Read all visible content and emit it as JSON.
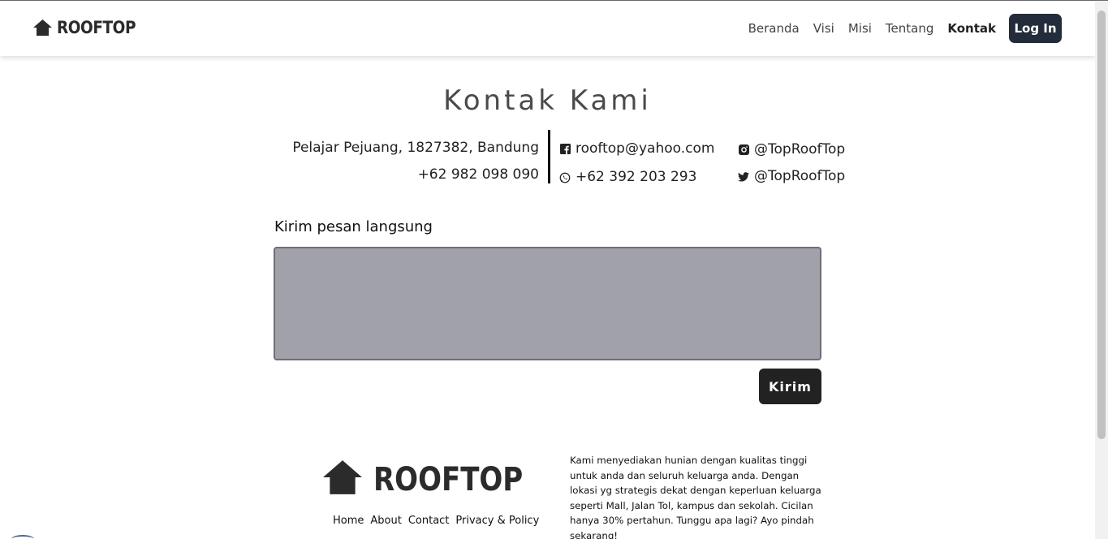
{
  "brand": {
    "name": "ROOFTOP",
    "icon": "house-icon"
  },
  "nav": {
    "items": [
      {
        "label": "Beranda",
        "active": false
      },
      {
        "label": "Visi",
        "active": false
      },
      {
        "label": "Misi",
        "active": false
      },
      {
        "label": "Tentang",
        "active": false
      },
      {
        "label": "Kontak",
        "active": true
      }
    ],
    "login_label": "Log In"
  },
  "contact": {
    "title": "Kontak Kami",
    "address": "Pelajar Pejuang, 1827382, Bandung",
    "phone": "+62 982 098 090",
    "email": "rooftop@yahoo.com",
    "whatsapp": "+62 392 203 293",
    "instagram": "@TopRoofTop",
    "twitter": "@TopRoofTop"
  },
  "message": {
    "label": "Kirim pesan langsung",
    "value": "",
    "send_label": "Kirim"
  },
  "footer": {
    "brand": "ROOFTOP",
    "links": [
      "Home",
      "About",
      "Contact",
      "Privacy & Policy"
    ],
    "description": "Kami menyediakan hunian dengan kualitas tinggi untuk anda dan seluruh keluarga anda. Dengan lokasi yg strategis dekat dengan keperluan keluarga seperti Mall, Jalan Tol, kampus dan sekolah. Cicilan hanya 30% pertahun. Tunggu apa lagi? Ayo pindah sekarang!"
  },
  "colors": {
    "nav_button": "#222c3a",
    "textarea_bg": "#a1a1aa",
    "send_button": "#222222"
  }
}
